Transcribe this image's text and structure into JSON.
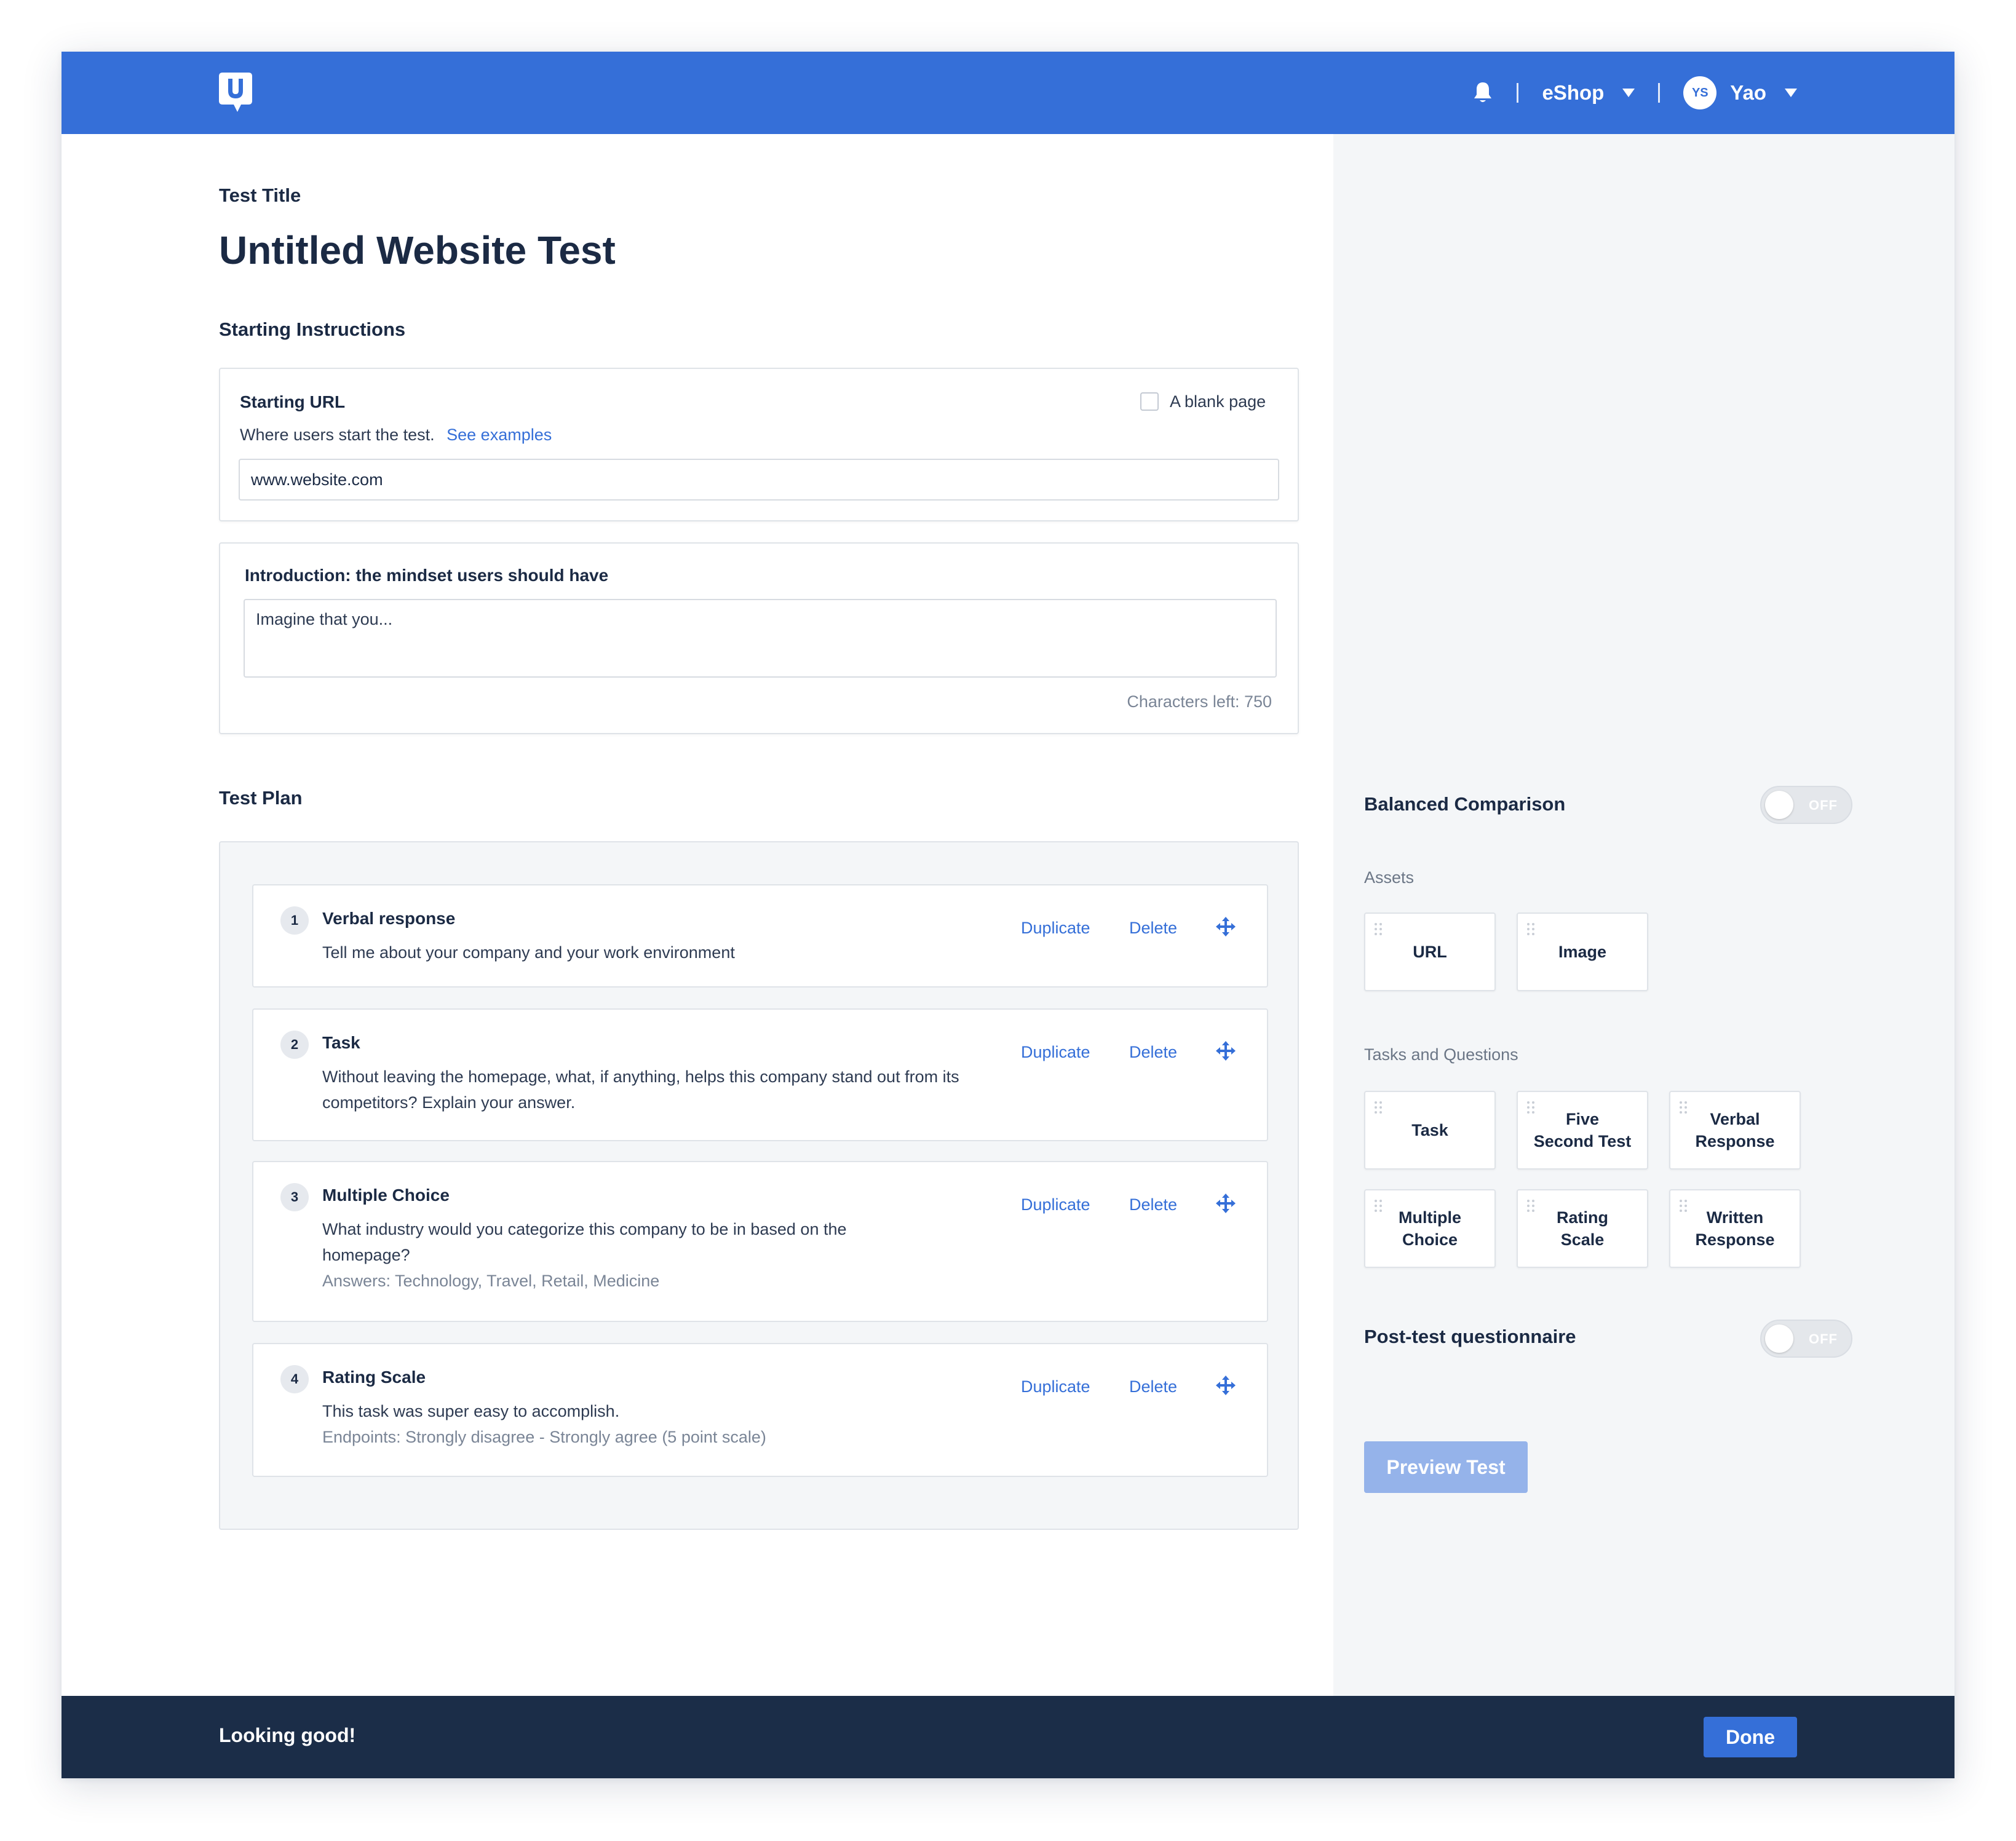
{
  "header": {
    "notifications_icon": "bell-icon",
    "workspace": "eShop",
    "user_initials": "YS",
    "user_name": "Yao",
    "brand_color": "#356fd8"
  },
  "editor": {
    "title_label": "Test Title",
    "title": "Untitled Website Test",
    "starting_instructions_label": "Starting Instructions",
    "starting_url": {
      "title": "Starting URL",
      "help": "Where users start the test.",
      "help_link": "See examples",
      "blank_page_label": "A blank page",
      "value": "www.website.com"
    },
    "introduction": {
      "title": "Introduction: the mindset users should have",
      "placeholder": "Imagine that you...",
      "chars_left": "Characters left: 750"
    },
    "test_plan_label": "Test Plan",
    "items": [
      {
        "number": "1",
        "type": "Verbal response",
        "text": "Tell me about your company and your work environment",
        "sub": ""
      },
      {
        "number": "2",
        "type": "Task",
        "text": "Without leaving the homepage, what, if anything, helps this company stand out from its competitors? Explain your answer.",
        "sub": ""
      },
      {
        "number": "3",
        "type": "Multiple Choice",
        "text": "What industry would you categorize this company to be in based on the homepage?",
        "sub": "Answers: Technology, Travel, Retail, Medicine"
      },
      {
        "number": "4",
        "type": "Rating Scale",
        "text": "This task was super easy to accomplish.",
        "sub": "Endpoints: Strongly disagree - Strongly agree (5 point scale)"
      }
    ],
    "duplicate_label": "Duplicate",
    "delete_label": "Delete"
  },
  "sidebar": {
    "balanced_comparison": "Balanced Comparison",
    "toggle_off": "OFF",
    "assets_label": "Assets",
    "assets": [
      "URL",
      "Image"
    ],
    "tasks_label": "Tasks and Questions",
    "tasks": [
      [
        "Task"
      ],
      [
        "Five",
        "Second Test"
      ],
      [
        "Verbal",
        "Response"
      ],
      [
        "Multiple",
        "Choice"
      ],
      [
        "Rating",
        "Scale"
      ],
      [
        "Written",
        "Response"
      ]
    ],
    "post_test": "Post-test questionnaire",
    "preview_button": "Preview Test"
  },
  "footer": {
    "message": "Looking good!",
    "done_button": "Done"
  }
}
